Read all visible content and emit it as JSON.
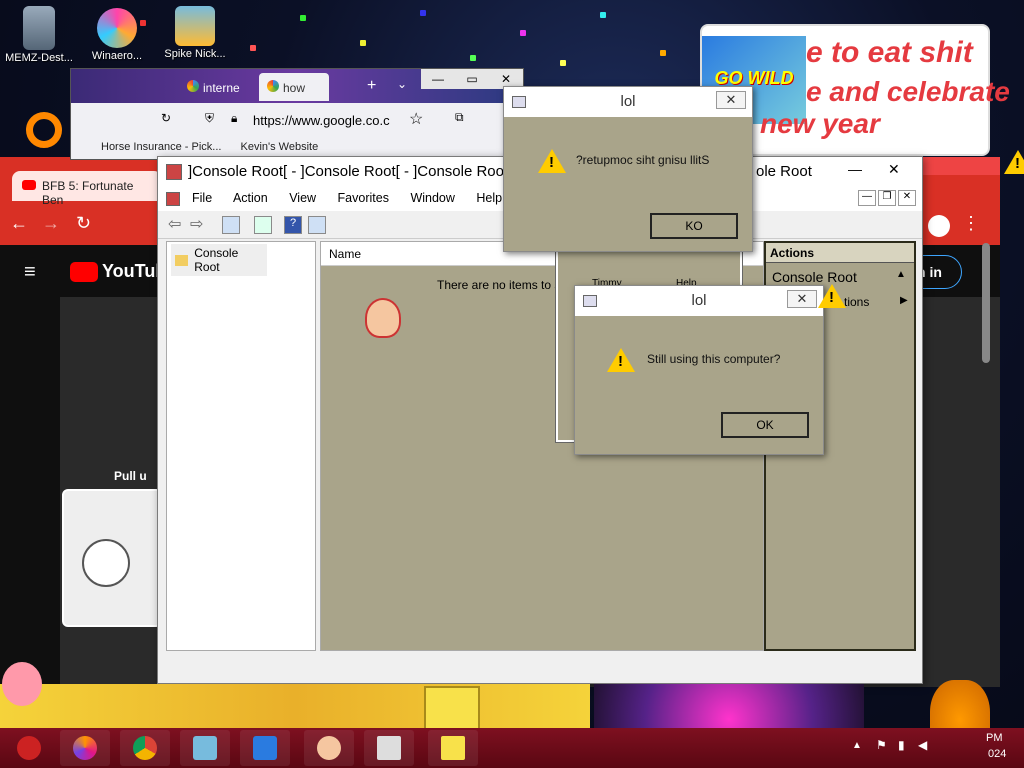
{
  "desktop": {
    "icons": [
      {
        "label": "MEMZ-Dest..."
      },
      {
        "label": "Winaero..."
      },
      {
        "label": "Spike Nick..."
      }
    ],
    "banner_text": {
      "line1": "e to eat shit",
      "line2": "e and celebrate",
      "line3": "new year"
    },
    "poster_text": "GO WILD"
  },
  "firefox": {
    "tabs": [
      {
        "label": "interne"
      },
      {
        "label": "how"
      }
    ],
    "url": "https://www.google.co.c",
    "bookmarks": [
      {
        "label": "Horse Insurance - Pick..."
      },
      {
        "label": "Kevin's Website"
      }
    ]
  },
  "chrome": {
    "tab_label": "BFB 5: Fortunate Ben",
    "youtube_logo": "YouTube",
    "pull_up": "Pull u",
    "sign_in": "n in"
  },
  "mmc": {
    "title": "]Console Root[ - ]Console Root[ - ]Console Root",
    "title_tail": "ole Root",
    "menu": [
      "File",
      "Action",
      "View",
      "Favorites",
      "Window",
      "Help"
    ],
    "tree_root": "Console Root",
    "list_header": "Name",
    "empty_text": "There are no items to s",
    "actions_header": "Actions",
    "actions_item": "Console Root",
    "actions_sub": "tions",
    "icon_labels": [
      "Timmy",
      "Help"
    ]
  },
  "dialogs": [
    {
      "title": "lol",
      "message": "?retupmoc siht gnisu llitS",
      "button": "KO"
    },
    {
      "title": "lol",
      "message": "Still using this computer?",
      "button": "OK"
    }
  ],
  "taskbar": {
    "apps": [
      "firefox",
      "chrome",
      "spike",
      "gowild",
      "timmy",
      "mmc",
      "spongebob"
    ],
    "clock": "PM",
    "year": "024"
  }
}
